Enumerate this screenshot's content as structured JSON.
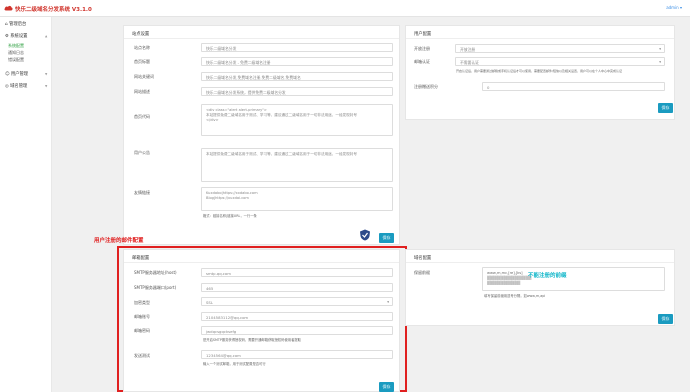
{
  "header": {
    "title": "快乐二级域名分发系统 V3.1.0",
    "admin": "admin ▾"
  },
  "sidebar": {
    "home": "管理后台",
    "system": "系统设置",
    "system_sub": [
      "系统配置",
      "通知日志",
      "错误配置"
    ],
    "users": "用户管理",
    "domains": "域名管理"
  },
  "basic": {
    "title": "站点设置",
    "site_name_label": "站点名称",
    "site_name_value": "快乐二级域名分发",
    "title_label": "首页标题",
    "title_value": "快乐二级域名分发 - 免费二级域名注册",
    "keywords_label": "网站关键词",
    "keywords_value": "快乐二级域名分发,免费域名注册,免费二级域名,免费域名",
    "desc_label": "网站描述",
    "desc_value": "快乐二级域名分发系统，提供免费二级域名分发",
    "home_code_label": "首页代码",
    "home_code_lines": [
      "<div class=\"alert alert-primary\">",
      "本站提供免费二级域名用于测试、学习等，建议通过二级域名用于一切非法用途，一经发现封号",
      "</div>"
    ],
    "notice_label": "用户公告",
    "notice_value": "本站提供免费二级域名用于测试、学习等，建议通过二级域名用于一切非法用途，一经发现封号",
    "links_label": "友情链接",
    "links_lines": [
      "Kuxdabo|https://xxdabo.com",
      "Blog|https://xuxdai.com"
    ],
    "links_hint": "格式：链接名称|链接URL，一行一条",
    "save": "保存"
  },
  "register": {
    "title": "用户配置",
    "open_label": "开放注册",
    "open_value": "开放注册",
    "verify_label": "邮箱认证",
    "verify_value": "不需要认证",
    "verify_hint": "开启认证后，用户需要通过邮箱或手机认证后才可以使用，需要配置邮件/短信以及相关设置，用户可以在个人中心中完成认证",
    "points_label": "注册赠送积分",
    "points_value": "0",
    "save": "保存"
  },
  "mail": {
    "annotation": "用户注册的邮件配置",
    "title": "邮箱配置",
    "smtp_host_label": "SMTP服务器地址(host)",
    "smtp_host_value": "smtp.qq.com",
    "smtp_port_label": "SMTP服务器端口(port)",
    "smtp_port_value": "465",
    "enc_label": "加密类型",
    "enc_value": "SSL",
    "account_label": "邮箱账号",
    "account_value": "2104583112@qq.com",
    "pwd_label": "邮箱密码",
    "pwd_value": "jwdqcsgqcksefg",
    "pwd_hint": "是开启SMTP服务获得授权码，需要开通邮箱获取授权码使用者提取",
    "sender_label": "发送测试",
    "sender_value": "1234564@qq.com",
    "sender_hint": "输入一个测试邮箱，用于测试配置是否可行",
    "save": "保存"
  },
  "auth": {
    "title": "域名配置",
    "label": "保留前缀",
    "lines": [
      "www,m,mc,[re],[ks]",
      "▓▓▓▓▓▓▓▓▓▓▓▓▓▓▓▓",
      "▓▓▓▓▓▓▓▓▓▓▓▓"
    ],
    "hint": "填写保留前缀用逗号分隔，如www,m,api",
    "annotation": "不能注册的前缀",
    "save": "保存"
  },
  "colors": {
    "brand": "#d0342c",
    "accent": "#1a9bc0",
    "annotation_red": "#e02020",
    "annotation_cyan": "#0fb6c9"
  }
}
